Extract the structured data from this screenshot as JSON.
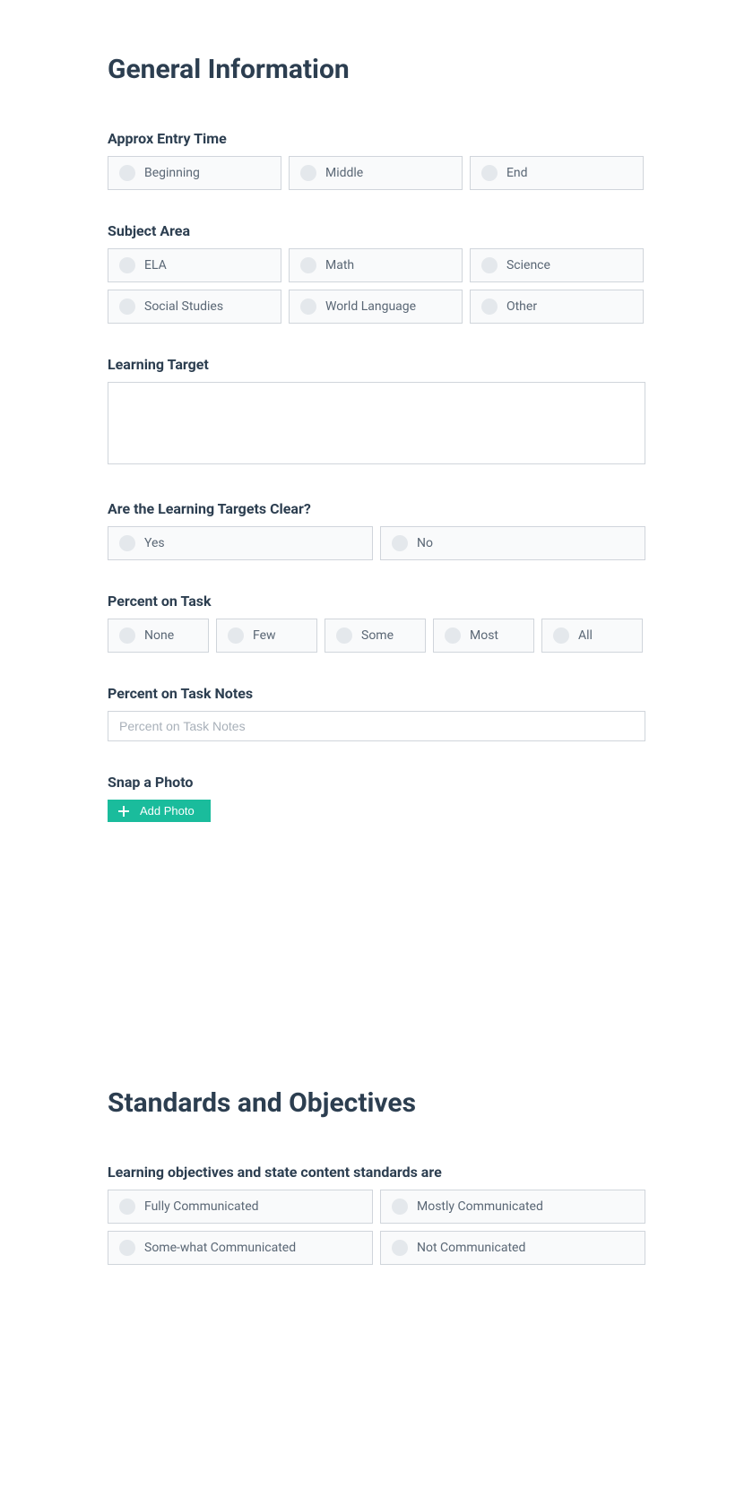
{
  "section1": {
    "title": "General Information",
    "entry_time": {
      "label": "Approx Entry Time",
      "options": [
        "Beginning",
        "Middle",
        "End"
      ]
    },
    "subject_area": {
      "label": "Subject Area",
      "options": [
        "ELA",
        "Math",
        "Science",
        "Social Studies",
        "World Language",
        "Other"
      ]
    },
    "learning_target": {
      "label": "Learning Target",
      "value": ""
    },
    "targets_clear": {
      "label": "Are the Learning Targets Clear?",
      "options": [
        "Yes",
        "No"
      ]
    },
    "percent_on_task": {
      "label": "Percent on Task",
      "options": [
        "None",
        "Few",
        "Some",
        "Most",
        "All"
      ]
    },
    "percent_on_task_notes": {
      "label": "Percent on Task Notes",
      "placeholder": "Percent on Task Notes",
      "value": ""
    },
    "snap_photo": {
      "label": "Snap a Photo",
      "button": "Add Photo"
    }
  },
  "section2": {
    "title": "Standards and Objectives",
    "learning_objectives": {
      "label": "Learning objectives and state content standards are",
      "options": [
        "Fully Communicated",
        "Mostly Communicated",
        "Some-what Communicated",
        "Not Communicated"
      ]
    }
  }
}
